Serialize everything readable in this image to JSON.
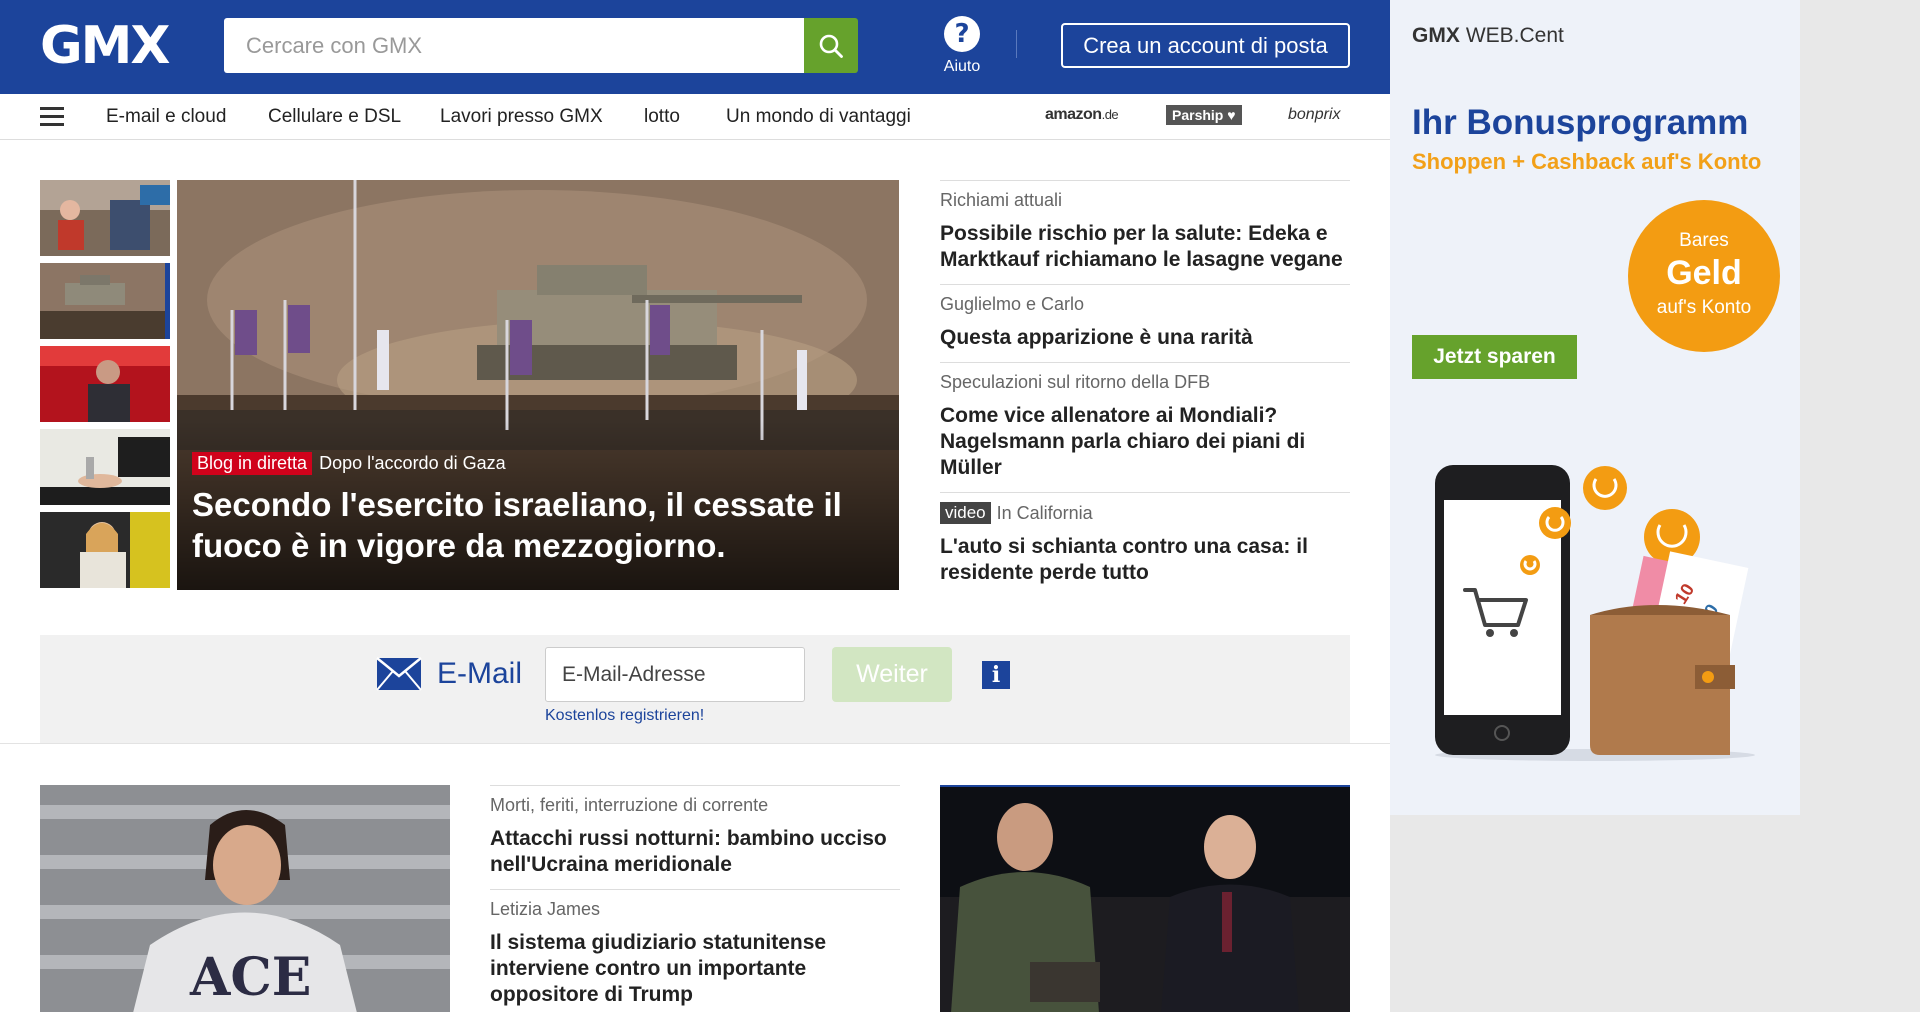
{
  "header": {
    "logo": "GMX",
    "search_placeholder": "Cercare con GMX",
    "help_label": "Aiuto",
    "create_account_label": "Crea un account di posta"
  },
  "nav": {
    "items": [
      "E-mail e cloud",
      "Cellulare e DSL",
      "Lavori presso GMX",
      "lotto",
      "Un mondo di vantaggi"
    ],
    "partners": {
      "amazon": "amazon",
      "amazon_suffix": ".de",
      "parship": "Parship ♥",
      "bonprix": "bonprix"
    }
  },
  "hero": {
    "badge": "Blog in diretta",
    "kicker": "Dopo l'accordo di Gaza",
    "title": "Secondo l'esercito israeliano, il cessate il fuoco è in vigore da mezzogiorno."
  },
  "news": [
    {
      "kicker": "Richiami attuali",
      "title": "Possibile rischio per la salute: Edeka e Marktkauf richiamano le lasagne vegane"
    },
    {
      "kicker": "Guglielmo e Carlo",
      "title": "Questa apparizione è una rarità"
    },
    {
      "kicker": "Speculazioni sul ritorno della DFB",
      "title": "Come vice allenatore ai Mondiali? Nagelsmann parla chiaro dei piani di Müller"
    },
    {
      "badge": "video",
      "kicker": "In California",
      "title": "L'auto si schianta contro una casa: il residente perde tutto"
    }
  ],
  "login": {
    "mail_label": "E-Mail",
    "email_placeholder": "E-Mail-Adresse",
    "register_link": "Kostenlos registrieren!",
    "submit_label": "Weiter",
    "info_label": "i"
  },
  "lower_news": [
    {
      "kicker": "Morti, feriti, interruzione di corrente",
      "title": "Attacchi russi notturni: bambino ucciso nell'Ucraina meridionale"
    },
    {
      "kicker": "Letizia James",
      "title": "Il sistema giudiziario statunitense interviene contro un importante oppositore di Trump"
    }
  ],
  "ad": {
    "brand": "GMX",
    "brand_suffix": "WEB.Cent",
    "title": "Ihr Bonusprogramm",
    "subtitle": "Shoppen + Cashback auf's Konto",
    "circle_top": "Bares",
    "circle_mid": "Geld",
    "circle_bottom": "auf's Konto",
    "cta": "Jetzt sparen",
    "banknote_values": [
      "10",
      "20"
    ]
  },
  "colors": {
    "brand_blue": "#1c449b",
    "accent_green": "#66a22c",
    "accent_orange": "#f39c12",
    "live_red": "#d0021b"
  },
  "icons": {
    "search": "magnifier-icon",
    "help": "question-circle-icon",
    "menu": "hamburger-icon",
    "mail": "envelope-icon",
    "info": "info-icon"
  }
}
